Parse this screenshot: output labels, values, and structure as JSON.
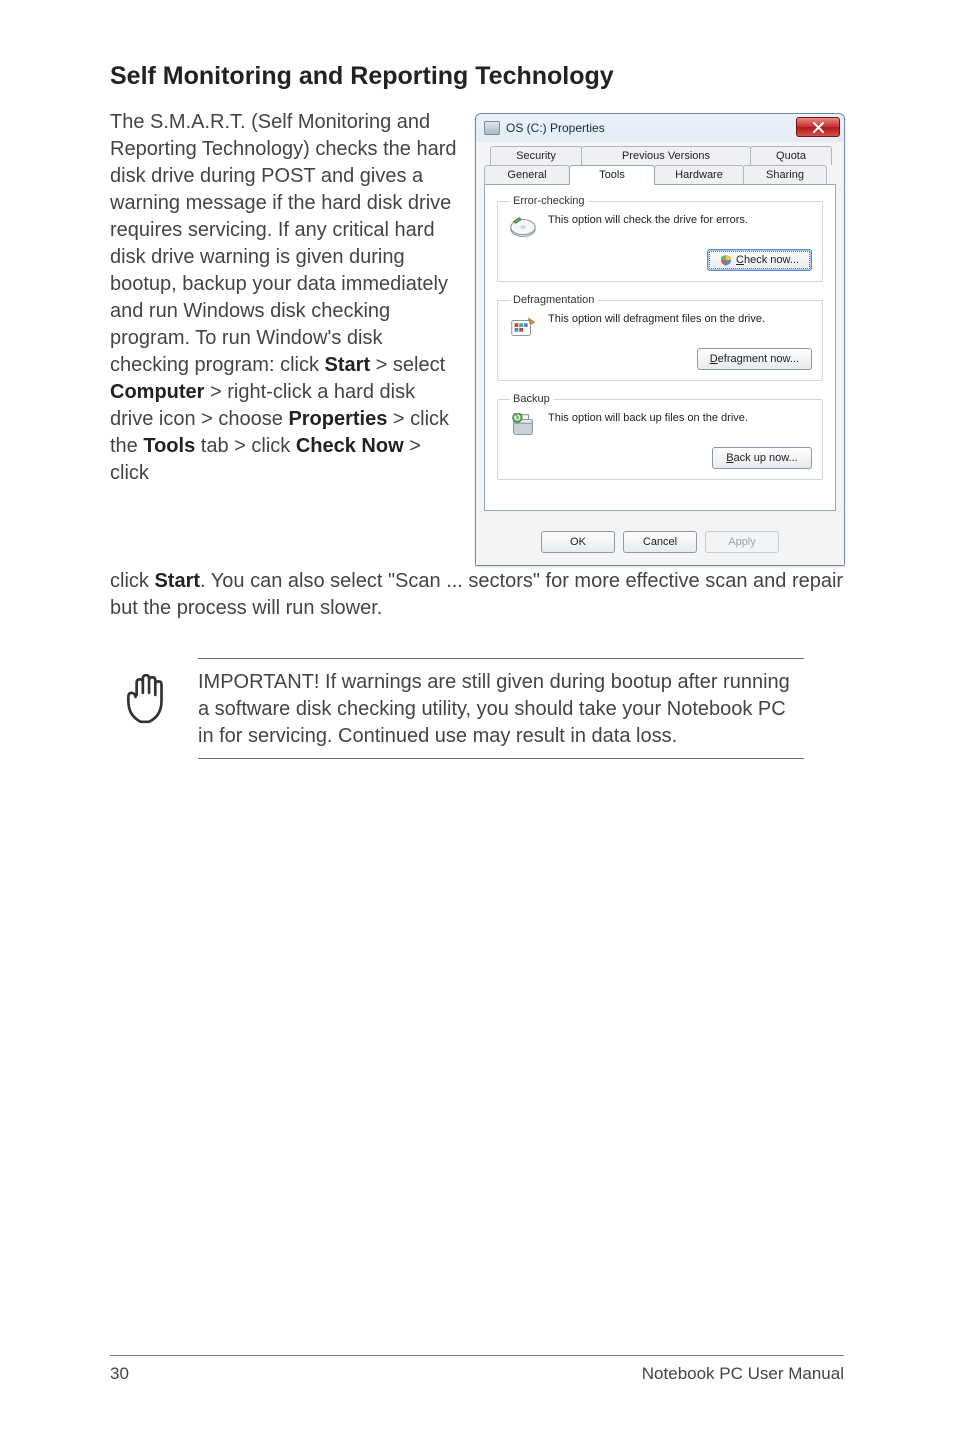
{
  "heading": "Self Monitoring and Reporting Technology",
  "para_left": "The S.M.A.R.T. (Self Monitoring and Reporting Technology) checks the hard disk drive during POST and gives a warning message if the hard disk drive requires servicing. If any critical hard disk drive warning is given during bootup, backup your data immediately and run Windows disk checking program. To run Window's disk checking program: click ",
  "kw_start": "Start",
  "seg1": " > select ",
  "kw_computer": "Computer",
  "seg2": " > right-click a hard disk drive icon > choose ",
  "kw_properties": "Properties",
  "seg3": " > click the ",
  "kw_tools": "Tools",
  "seg4": " tab > click ",
  "kw_checknow": "Check Now",
  "seg5": " > click ",
  "kw_start2": "Start",
  "para_full_tail": ". You can also select \"Scan ... sectors\" for more effective scan and repair but the process will run slower.",
  "note": "IMPORTANT! If warnings are still given during bootup after running a software disk checking utility, you should take your Notebook PC in for servicing. Continued use may result in data loss.",
  "footer_page": "30",
  "footer_right": "Notebook PC User Manual",
  "dialog": {
    "title": "OS (C:) Properties",
    "tabs_back": {
      "security": "Security",
      "prev": "Previous Versions",
      "quota": "Quota"
    },
    "tabs_front": {
      "general": "General",
      "tools": "Tools",
      "hardware": "Hardware",
      "sharing": "Sharing"
    },
    "groups": {
      "error": {
        "legend": "Error-checking",
        "desc": "This option will check the drive for errors.",
        "btn_pre": "C",
        "btn_rest": "heck now..."
      },
      "defrag": {
        "legend": "Defragmentation",
        "desc": "This option will defragment files on the drive.",
        "btn_pre": "D",
        "btn_rest": "efragment now..."
      },
      "backup": {
        "legend": "Backup",
        "desc": "This option will back up files on the drive.",
        "btn_pre": "B",
        "btn_rest": "ack up now..."
      }
    },
    "buttons": {
      "ok": "OK",
      "cancel": "Cancel",
      "apply": "Apply"
    }
  },
  "chart_data": {
    "type": "table",
    "title": "OS (C:) Properties — Tools tab",
    "rows": [
      {
        "group": "Error-checking",
        "description": "This option will check the drive for errors.",
        "action": "Check now..."
      },
      {
        "group": "Defragmentation",
        "description": "This option will defragment files on the drive.",
        "action": "Defragment now..."
      },
      {
        "group": "Backup",
        "description": "This option will back up files on the drive.",
        "action": "Back up now..."
      }
    ],
    "dialog_buttons": [
      "OK",
      "Cancel",
      "Apply"
    ]
  }
}
